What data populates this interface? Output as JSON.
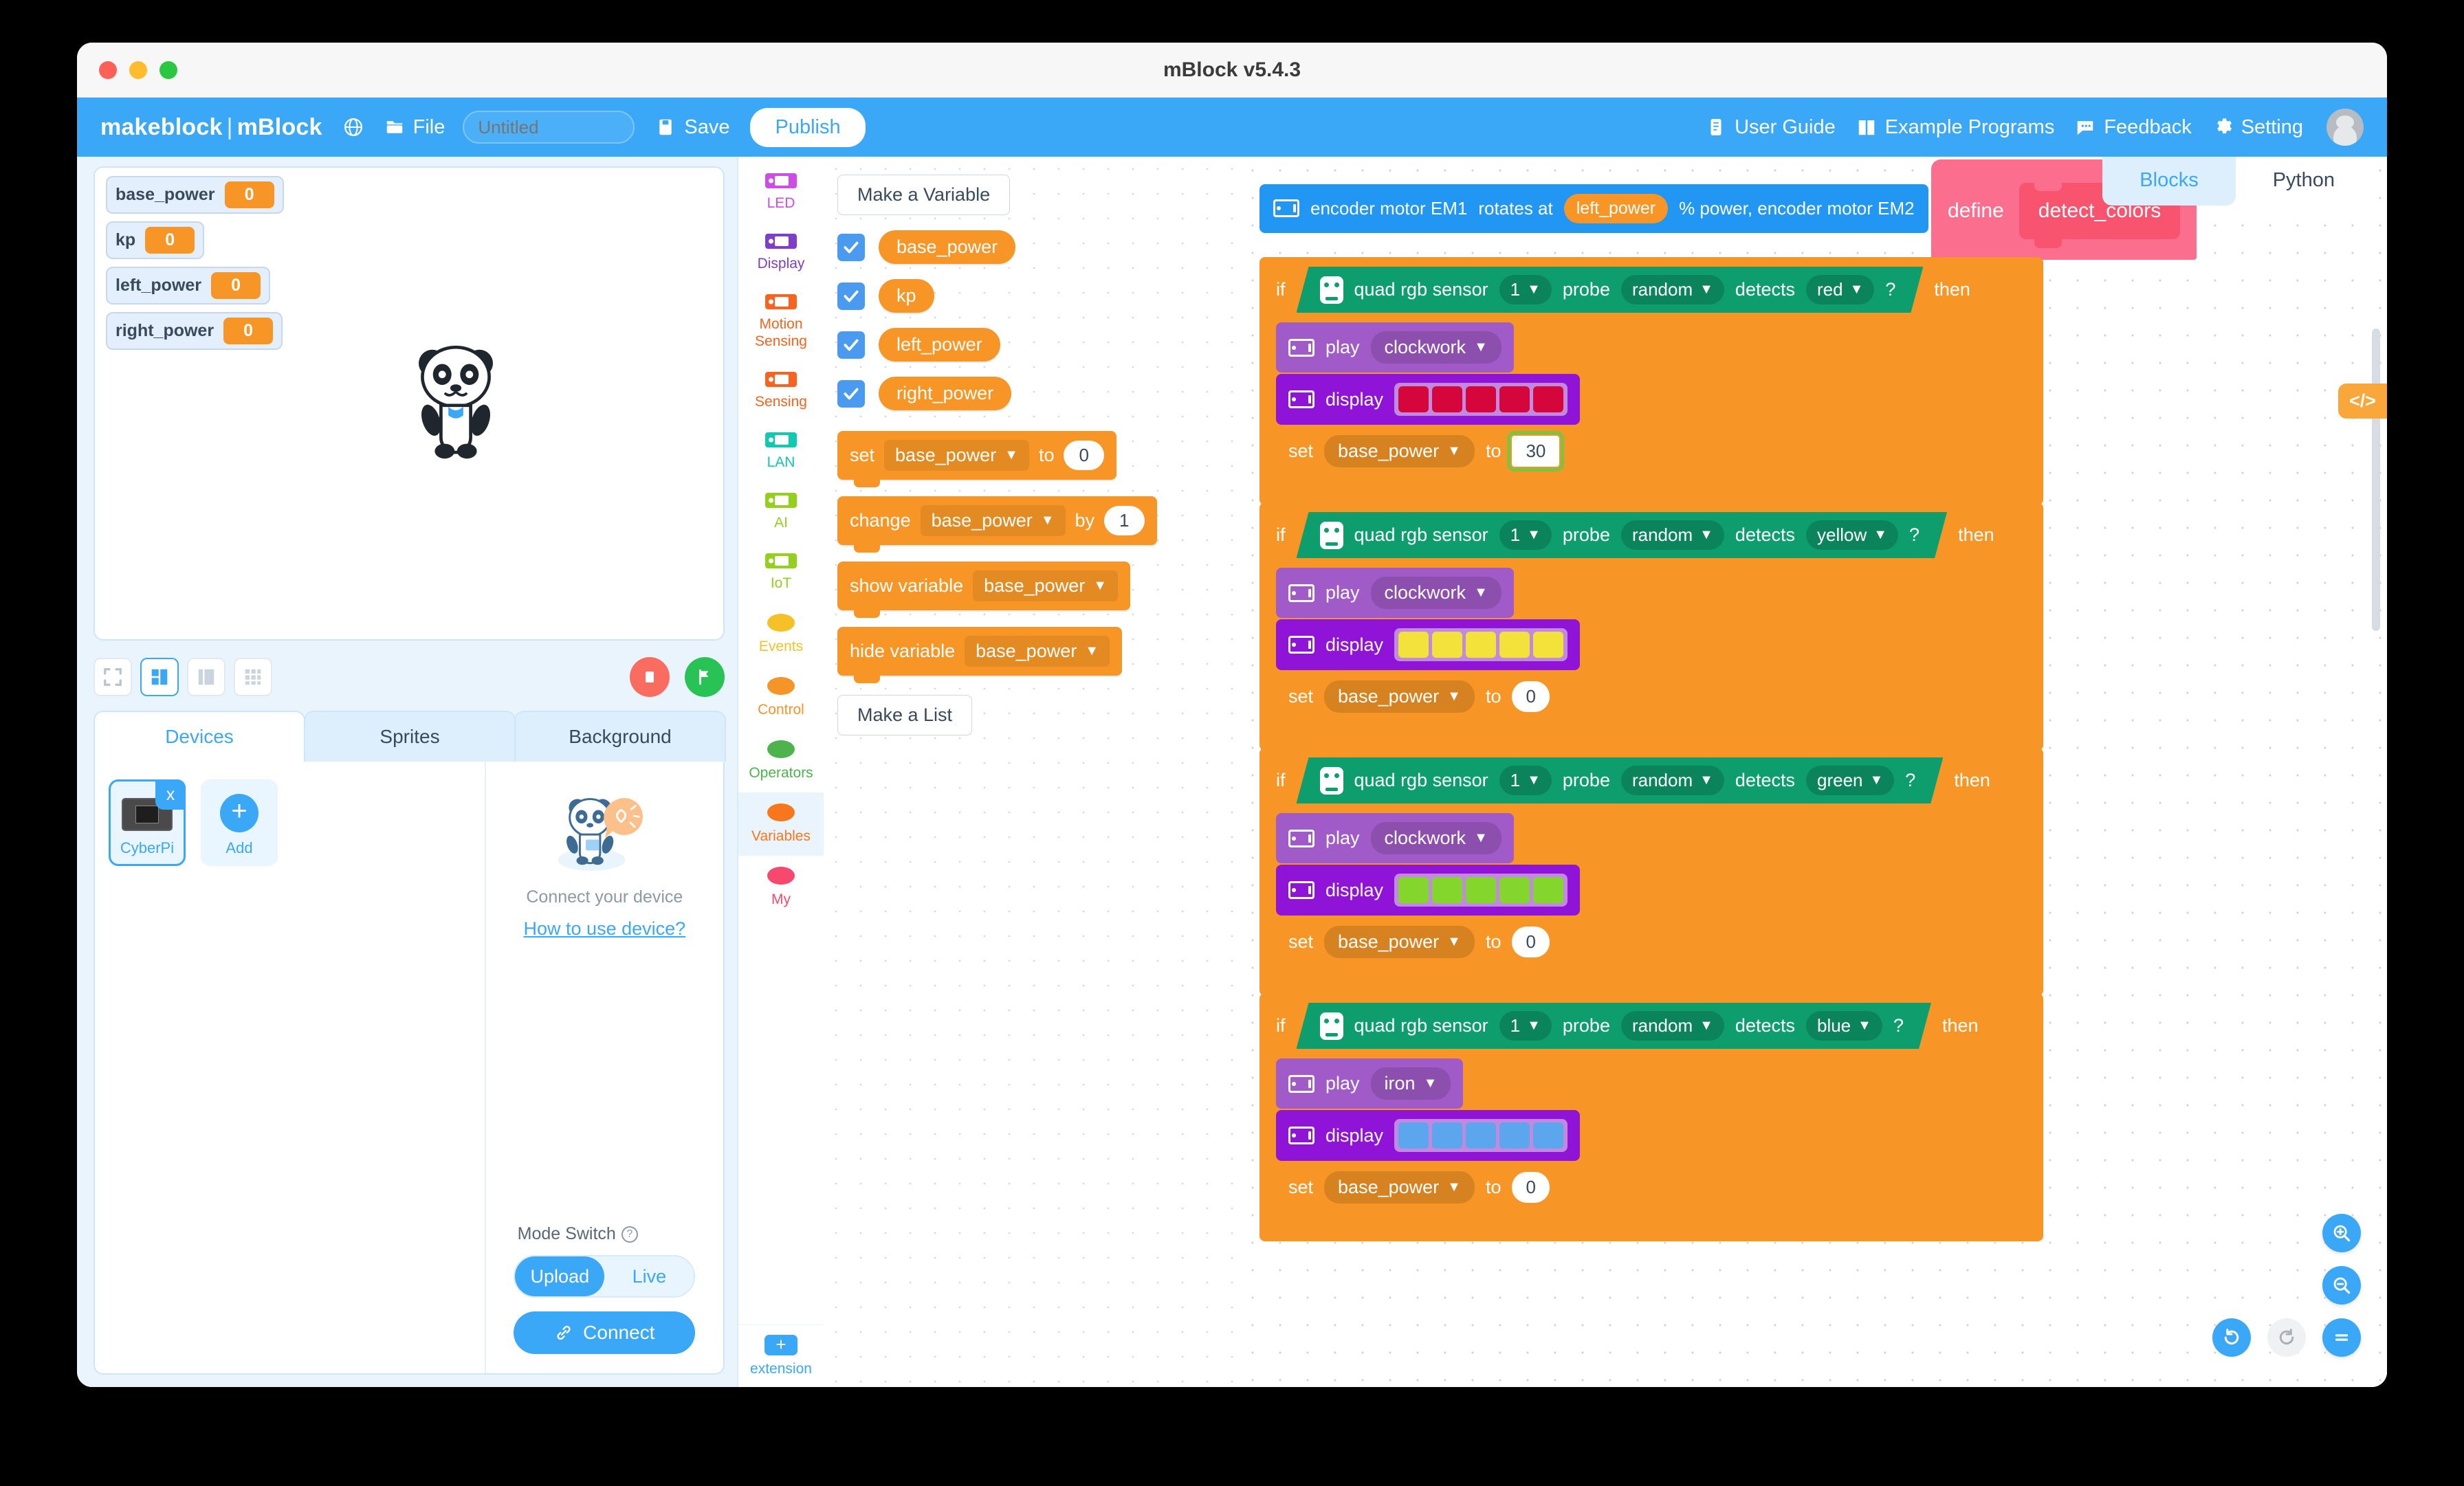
{
  "window": {
    "title": "mBlock v5.4.3",
    "traffic_lights": [
      "close",
      "minimize",
      "zoom"
    ]
  },
  "toolbar": {
    "brand_left": "makeblock",
    "brand_sep": "|",
    "brand_right": "mBlock",
    "globe_icon": "globe-icon",
    "file_icon": "file-icon",
    "file_label": "File",
    "project_name": "",
    "project_placeholder": "Untitled",
    "save_icon": "save-icon",
    "save_label": "Save",
    "publish_label": "Publish",
    "right_items": [
      {
        "icon": "book-icon",
        "label": "User Guide"
      },
      {
        "icon": "examples-icon",
        "label": "Example Programs"
      },
      {
        "icon": "feedback-icon",
        "label": "Feedback"
      },
      {
        "icon": "gear-icon",
        "label": "Setting"
      }
    ],
    "avatar": "user-avatar"
  },
  "stage": {
    "monitors": [
      {
        "name": "base_power",
        "value": "0"
      },
      {
        "name": "kp",
        "value": "0"
      },
      {
        "name": "left_power",
        "value": "0"
      },
      {
        "name": "right_power",
        "value": "0"
      }
    ],
    "sprite": "panda-sprite",
    "layout_buttons": [
      "fullscreen-layout",
      "small-stage-layout",
      "large-stage-layout",
      "grid-layout"
    ],
    "active_layout": 1,
    "stop_button": "stop-button",
    "start_button": "green-flag-button"
  },
  "device_panel": {
    "tabs": [
      {
        "label": "Devices",
        "active": true
      },
      {
        "label": "Sprites",
        "active": false
      },
      {
        "label": "Background",
        "active": false
      }
    ],
    "devices": [
      {
        "label": "CyberPi",
        "selected": true,
        "close": "x"
      }
    ],
    "add_label": "Add",
    "connect_title": "Connect your device",
    "how_link": "How to use device?",
    "mode_switch_label": "Mode Switch",
    "modes": [
      {
        "label": "Upload",
        "active": true
      },
      {
        "label": "Live",
        "active": false
      }
    ],
    "connect_button": "Connect"
  },
  "palette": {
    "categories": [
      {
        "label": "LED",
        "color": "#cf4ce6",
        "shape": "rect"
      },
      {
        "label": "Display",
        "color": "#7d3fc9",
        "shape": "rect"
      },
      {
        "label": "Motion Sensing",
        "color": "#f8641f",
        "shape": "rect"
      },
      {
        "label": "Sensing",
        "color": "#f8641f",
        "shape": "rect"
      },
      {
        "label": "LAN",
        "color": "#0fc9b0",
        "shape": "rect"
      },
      {
        "label": "AI",
        "color": "#94cf1d",
        "shape": "rect"
      },
      {
        "label": "IoT",
        "color": "#94cf1d",
        "shape": "rect"
      },
      {
        "label": "Events",
        "color": "#f5c028",
        "shape": "circle"
      },
      {
        "label": "Control",
        "color": "#f59427",
        "shape": "circle"
      },
      {
        "label": "Operators",
        "color": "#4db34d",
        "shape": "circle"
      },
      {
        "label": "Variables",
        "color": "#f8761c",
        "shape": "circle",
        "active": true
      },
      {
        "label": "My",
        "color": "#f8486e",
        "shape": "circle"
      }
    ],
    "extension_label": "extension",
    "make_variable_button": "Make a Variable",
    "make_list_button": "Make a List",
    "variables": [
      {
        "name": "base_power",
        "checked": true
      },
      {
        "name": "kp",
        "checked": true
      },
      {
        "name": "left_power",
        "checked": true
      },
      {
        "name": "right_power",
        "checked": true
      }
    ],
    "blocks": [
      {
        "id": "set",
        "prefix": "set",
        "dropdown": "base_power",
        "mid": "to",
        "value": "0"
      },
      {
        "id": "change",
        "prefix": "change",
        "dropdown": "base_power",
        "mid": "by",
        "value": "1"
      },
      {
        "id": "show",
        "prefix": "show variable",
        "dropdown": "base_power"
      },
      {
        "id": "hide",
        "prefix": "hide variable",
        "dropdown": "base_power"
      }
    ]
  },
  "workspace": {
    "code_tabs": [
      {
        "label": "Blocks",
        "active": false
      },
      {
        "label": "Python",
        "active": true
      }
    ],
    "code_toggle": "</>",
    "partial_block": {
      "text_a": "encoder motor EM1",
      "text_b": "rotates at",
      "var": "left_power",
      "text_c": "% power, encoder motor EM2"
    },
    "define": {
      "keyword": "define",
      "name": "detect_colors"
    },
    "branches": [
      {
        "if_label": "if",
        "then_label": "then",
        "condition": {
          "icon": "cyberpi-robot-icon",
          "text_sensor": "quad rgb sensor",
          "index": "1",
          "text_probe": "probe",
          "probe": "random",
          "text_detects": "detects",
          "color": "red",
          "q": "?"
        },
        "body": [
          {
            "type": "play",
            "label": "play",
            "value": "clockwork"
          },
          {
            "type": "display",
            "label": "display",
            "led_color": "#d5063b",
            "cells": 5
          },
          {
            "type": "set",
            "label": "set",
            "dropdown": "base_power",
            "mid": "to",
            "value": "30",
            "selected": true
          }
        ]
      },
      {
        "if_label": "if",
        "then_label": "then",
        "condition": {
          "icon": "cyberpi-robot-icon",
          "text_sensor": "quad rgb sensor",
          "index": "1",
          "text_probe": "probe",
          "probe": "random",
          "text_detects": "detects",
          "color": "yellow",
          "q": "?"
        },
        "body": [
          {
            "type": "play",
            "label": "play",
            "value": "clockwork"
          },
          {
            "type": "display",
            "label": "display",
            "led_color": "#f3e23a",
            "cells": 5
          },
          {
            "type": "set",
            "label": "set",
            "dropdown": "base_power",
            "mid": "to",
            "value": "0",
            "selected": false
          }
        ]
      },
      {
        "if_label": "if",
        "then_label": "then",
        "condition": {
          "icon": "cyberpi-robot-icon",
          "text_sensor": "quad rgb sensor",
          "index": "1",
          "text_probe": "probe",
          "probe": "random",
          "text_detects": "detects",
          "color": "green",
          "q": "?"
        },
        "body": [
          {
            "type": "play",
            "label": "play",
            "value": "clockwork"
          },
          {
            "type": "display",
            "label": "display",
            "led_color": "#85d62c",
            "cells": 5
          },
          {
            "type": "set",
            "label": "set",
            "dropdown": "base_power",
            "mid": "to",
            "value": "0",
            "selected": false
          }
        ]
      },
      {
        "if_label": "if",
        "then_label": "then",
        "condition": {
          "icon": "cyberpi-robot-icon",
          "text_sensor": "quad rgb sensor",
          "index": "1",
          "text_probe": "probe",
          "probe": "random",
          "text_detects": "detects",
          "color": "blue",
          "q": "?"
        },
        "body": [
          {
            "type": "play",
            "label": "play",
            "value": "iron"
          },
          {
            "type": "display",
            "label": "display",
            "led_color": "#5ba6ed",
            "cells": 5
          },
          {
            "type": "set",
            "label": "set",
            "dropdown": "base_power",
            "mid": "to",
            "value": "0",
            "selected": false
          }
        ]
      }
    ],
    "float_buttons": [
      "zoom-in-button",
      "zoom-out-button",
      "zoom-reset-button"
    ],
    "undo_buttons": [
      "undo-button",
      "redo-button"
    ]
  },
  "colors": {
    "accent": "#3ba7f7",
    "variables": "#f79626",
    "sensing": "#0e9e6e",
    "display": "#9013d8",
    "led": "#a15bc8",
    "my_blocks": "#fc6e8e",
    "motion": "#2196f3"
  }
}
